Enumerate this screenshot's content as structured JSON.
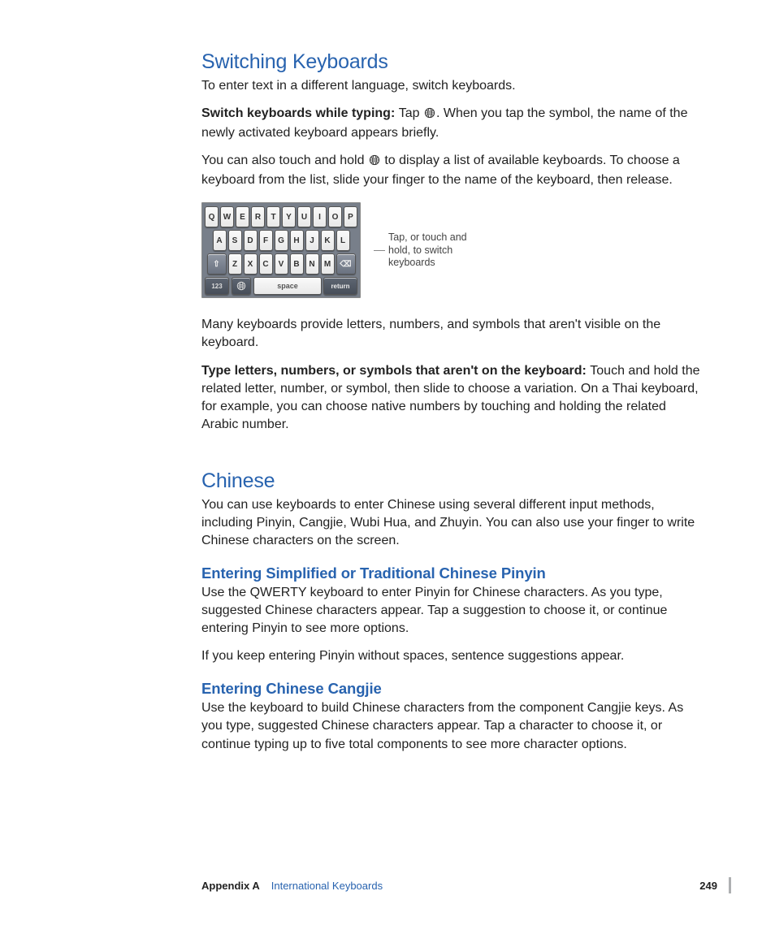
{
  "section1": {
    "heading": "Switching Keyboards",
    "p1": "To enter text in a different language, switch keyboards.",
    "p2_bold": "Switch keyboards while typing:  ",
    "p2_a": "Tap ",
    "p2_b": ". When you tap the symbol, the name of the newly activated keyboard appears briefly.",
    "p3_a": "You can also touch and hold ",
    "p3_b": " to display a list of available keyboards. To choose a keyboard from the list, slide your finger to the name of the keyboard, then release.",
    "keyboard": {
      "row1": [
        "Q",
        "W",
        "E",
        "R",
        "T",
        "Y",
        "U",
        "I",
        "O",
        "P"
      ],
      "row2": [
        "A",
        "S",
        "D",
        "F",
        "G",
        "H",
        "J",
        "K",
        "L"
      ],
      "row3": [
        "Z",
        "X",
        "C",
        "V",
        "B",
        "N",
        "M"
      ],
      "shift": "⇧",
      "backspace": "⌫",
      "n123": "123",
      "space": "space",
      "ret": "return"
    },
    "callout": "Tap, or touch and hold, to switch keyboards",
    "p4": "Many keyboards provide letters, numbers, and symbols that aren't visible on the keyboard.",
    "p5_bold": "Type letters, numbers, or symbols that aren't on the keyboard:  ",
    "p5": "Touch and hold the related letter, number, or symbol, then slide to choose a variation. On a Thai keyboard, for example, you can choose native numbers by touching and holding the related Arabic number."
  },
  "section2": {
    "heading": "Chinese",
    "p1": "You can use keyboards to enter Chinese using several different input methods, including Pinyin, Cangjie, Wubi Hua, and Zhuyin. You can also use your finger to write Chinese characters on the screen.",
    "sub1": "Entering Simplified or Traditional Chinese Pinyin",
    "sub1_p1": "Use the QWERTY keyboard to enter Pinyin for Chinese characters. As you type, suggested Chinese characters appear. Tap a suggestion to choose it, or continue entering Pinyin to see more options.",
    "sub1_p2": "If you keep entering Pinyin without spaces, sentence suggestions appear.",
    "sub2": "Entering Chinese Cangjie",
    "sub2_p1": "Use the keyboard to build Chinese characters from the component Cangjie keys. As you type, suggested Chinese characters appear. Tap a character to choose it, or continue typing up to five total components to see more character options."
  },
  "footer": {
    "appendix": "Appendix A",
    "title": "International Keyboards",
    "page": "249"
  }
}
